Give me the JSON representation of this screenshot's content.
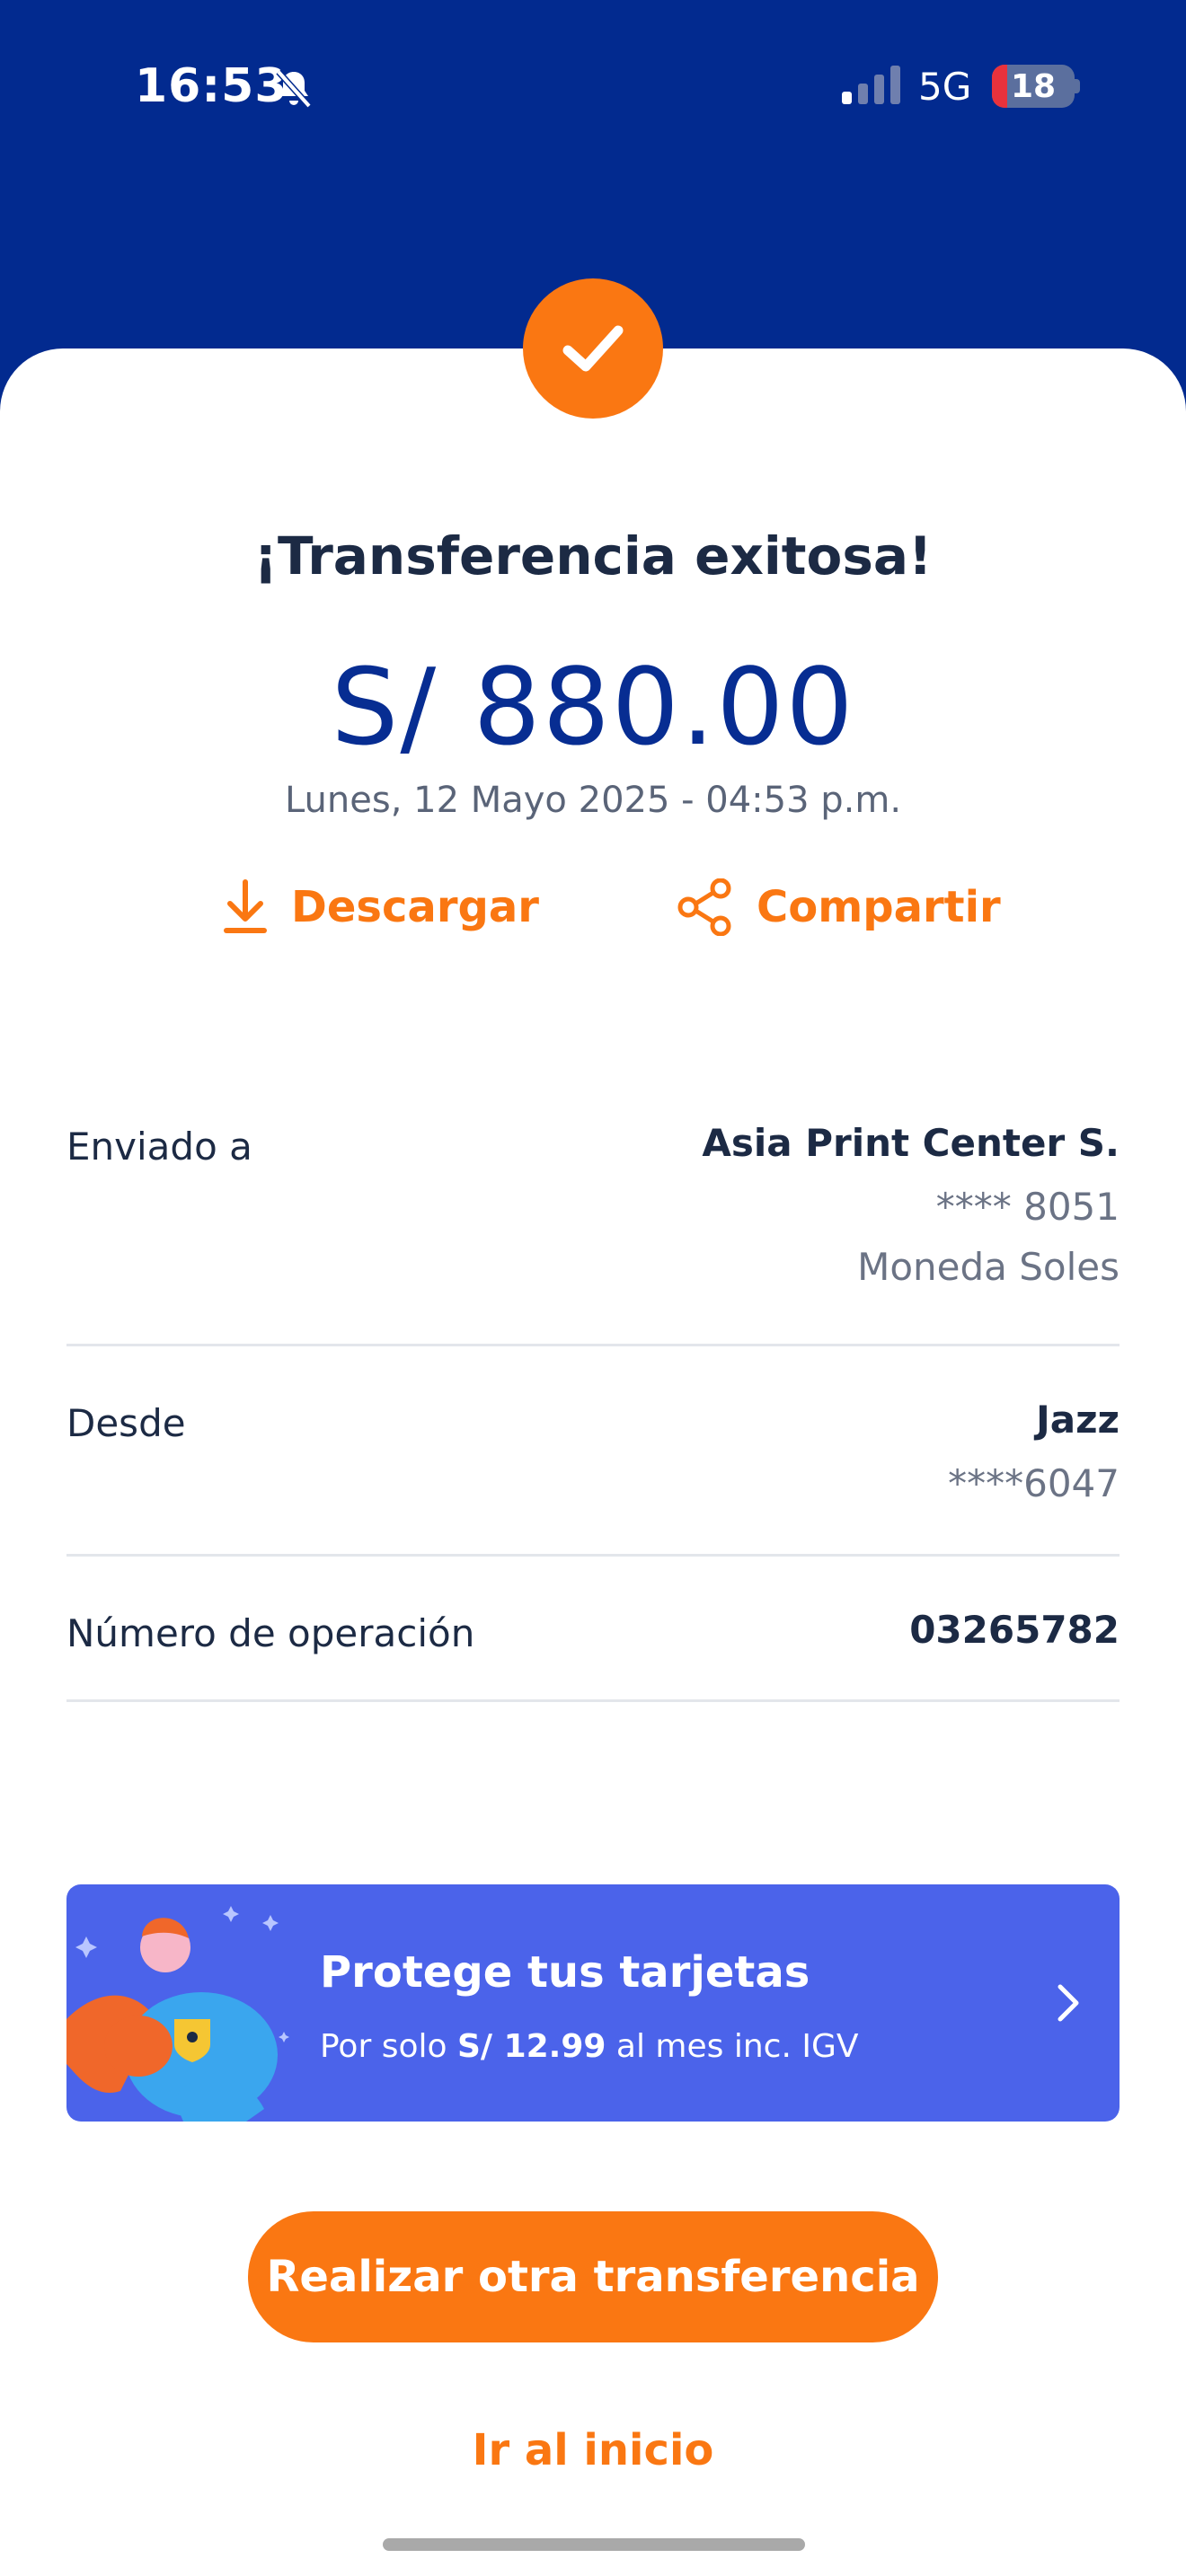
{
  "status_bar": {
    "time": "16:53",
    "network": "5G",
    "battery_level": "18",
    "battery_fraction": 0.18
  },
  "colors": {
    "header_blue": "#022a8f",
    "accent_orange": "#fa7712",
    "amount_blue": "#072d92",
    "promo_blue": "#4b63ea"
  },
  "receipt": {
    "title": "¡Transferencia exitosa!",
    "amount": "S/ 880.00",
    "datetime": "Lunes, 12 Mayo 2025 - 04:53 p.m.",
    "download_label": "Descargar",
    "share_label": "Compartir"
  },
  "details": {
    "sent_to": {
      "label": "Enviado a",
      "name": "Asia Print Center S.",
      "account": "**** 8051",
      "currency": "Moneda Soles"
    },
    "from": {
      "label": "Desde",
      "name": "Jazz",
      "account": "****6047"
    },
    "operation": {
      "label": "Número de operación",
      "number": "03265782"
    }
  },
  "promo": {
    "title": "Protege tus tarjetas",
    "sub_prefix": "Por solo",
    "sub_price": "S/ 12.99",
    "sub_suffix": "al mes inc. IGV"
  },
  "actions": {
    "primary_label": "Realizar otra transferencia",
    "home_label": "Ir al inicio"
  }
}
